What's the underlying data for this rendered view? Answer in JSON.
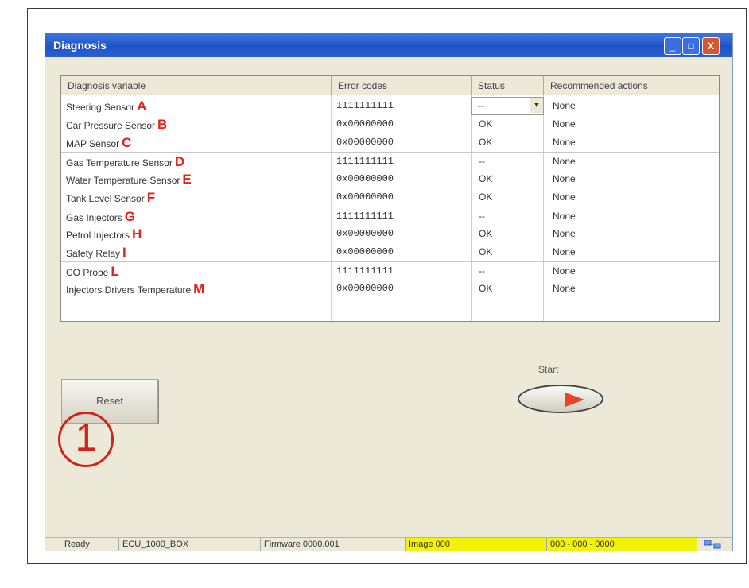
{
  "window": {
    "title": "Diagnosis",
    "controls": {
      "minimize": "_",
      "maximize": "□",
      "close": "X"
    }
  },
  "table": {
    "headers": [
      "Diagnosis variable",
      "Error codes",
      "Status",
      "Recommended actions"
    ],
    "rows": [
      {
        "name": "Steering Sensor",
        "marker": "A",
        "code": "1111111111",
        "status": "--",
        "action": "None"
      },
      {
        "name": "Car Pressure Sensor",
        "marker": "B",
        "code": "0x00000000",
        "status": "OK",
        "action": "None"
      },
      {
        "name": "MAP Sensor",
        "marker": "C",
        "code": "0x00000000",
        "status": "OK",
        "action": "None"
      },
      {
        "name": "Gas Temperature Sensor",
        "marker": "D",
        "code": "1111111111",
        "status": "--",
        "action": "None"
      },
      {
        "name": "Water Temperature Sensor",
        "marker": "E",
        "code": "0x00000000",
        "status": "OK",
        "action": "None"
      },
      {
        "name": "Tank Level Sensor",
        "marker": "F",
        "code": "0x00000000",
        "status": "OK",
        "action": "None"
      },
      {
        "name": "Gas Injectors",
        "marker": "G",
        "code": "1111111111",
        "status": "--",
        "action": "None"
      },
      {
        "name": "Petrol Injectors",
        "marker": "H",
        "code": "0x00000000",
        "status": "OK",
        "action": "None"
      },
      {
        "name": "Safety Relay",
        "marker": "I",
        "code": "0x00000000",
        "status": "OK",
        "action": "None"
      },
      {
        "name": "CO Probe",
        "marker": "L",
        "code": "1111111111",
        "status": "--",
        "action": "None"
      },
      {
        "name": "Injectors Drivers Temperature",
        "marker": "M",
        "code": "0x00000000",
        "status": "OK",
        "action": "None"
      }
    ],
    "combo_arrow": "▼"
  },
  "reset_button": {
    "label": "Reset"
  },
  "callout": {
    "label": "1"
  },
  "start": {
    "label": "Start"
  },
  "statusbar": {
    "items": [
      "Ready",
      "ECU_1000_BOX",
      "Firmware 0000.001",
      "Image 000",
      "000 - 000 - 0000"
    ],
    "icon": "network-icon"
  },
  "colors": {
    "marker": "#e0241c",
    "titlebar": "#2a5fd0",
    "statusbar_highlight": "#f2f20a",
    "callout": "#d1221c"
  }
}
